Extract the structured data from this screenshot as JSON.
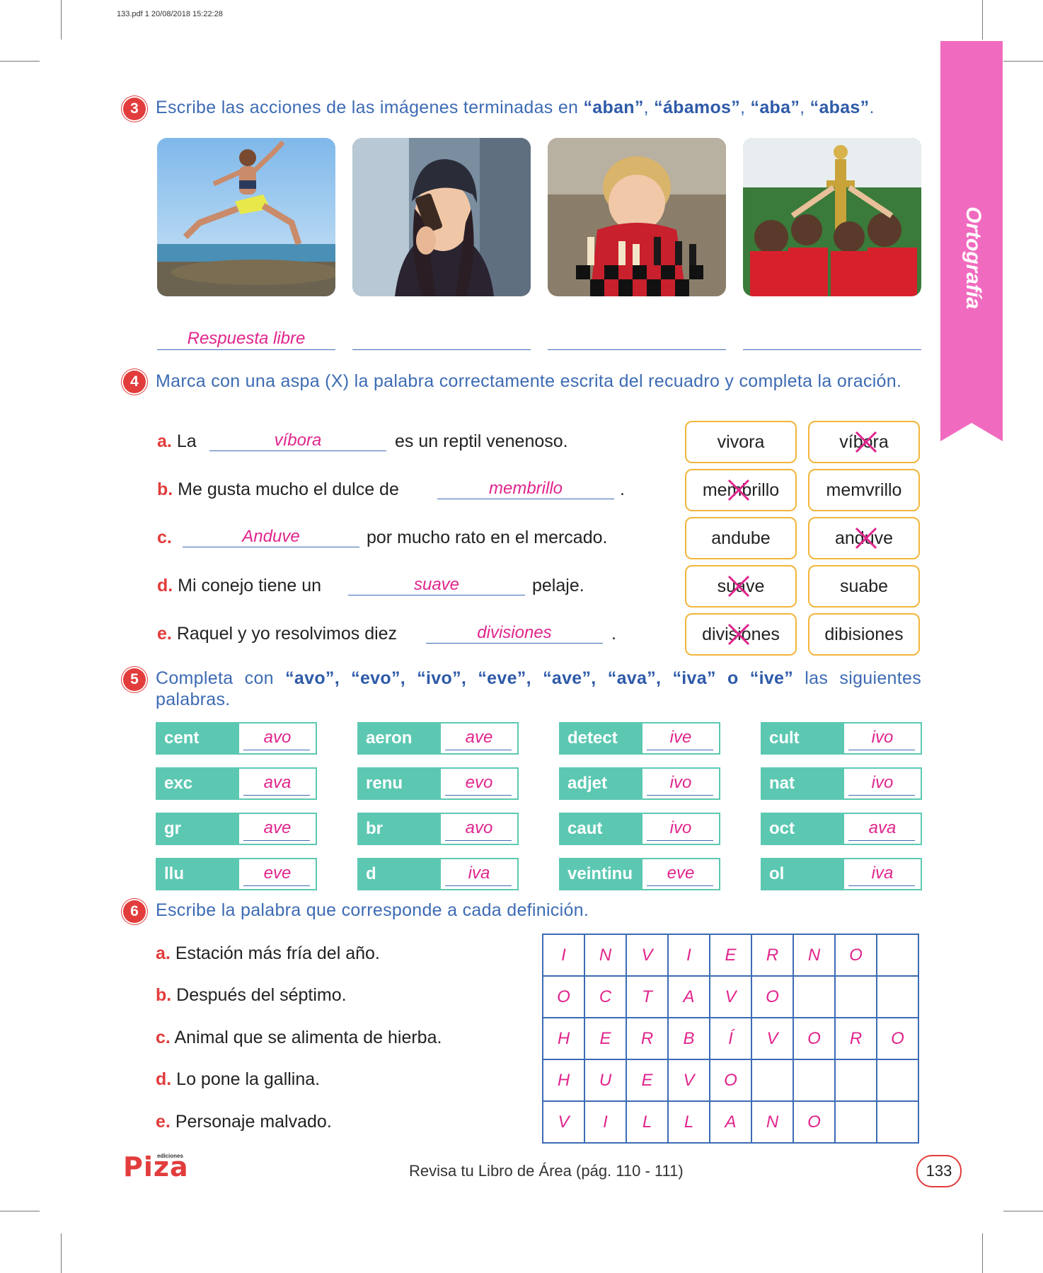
{
  "pdf_header": "133.pdf   1   20/08/2018   15:22:28",
  "side_tab": "Ortografía",
  "ex3": {
    "number": "3",
    "instruction_pre": "Escribe las acciones de las imágenes terminadas en ",
    "terms": [
      "“aban”",
      ", ",
      "“ábamos”",
      ", ",
      "“aba”",
      ", ",
      "“abas”",
      "."
    ],
    "answers": [
      "Respuesta libre",
      "",
      "",
      ""
    ]
  },
  "ex4": {
    "number": "4",
    "instruction": "Marca con una aspa (X) la palabra correctamente escrita del recuadro y completa la oración.",
    "items": [
      {
        "letter": "a.",
        "before": "La",
        "answer": "víbora",
        "after": "es un reptil venenoso.",
        "opt1": "vivora",
        "opt2": "víbora"
      },
      {
        "letter": "b.",
        "before": "Me gusta mucho el dulce de",
        "answer": "membrillo",
        "after": ".",
        "opt1": "membrillo",
        "opt2": "memvrillo"
      },
      {
        "letter": "c.",
        "before": "",
        "answer": "Anduve",
        "after": "por mucho rato en el mercado.",
        "opt1": "andube",
        "opt2": "anduve"
      },
      {
        "letter": "d.",
        "before": "Mi conejo tiene un",
        "answer": "suave",
        "after": "pelaje.",
        "opt1": "suave",
        "opt2": "suabe"
      },
      {
        "letter": "e.",
        "before": "Raquel y yo resolvimos diez",
        "answer": "divisiones",
        "after": ".",
        "opt1": "divisiones",
        "opt2": "dibisiones"
      }
    ]
  },
  "ex5": {
    "number": "5",
    "instruction_pre": "Completa con ",
    "instruction_terms": "“avo”, “evo”, “ivo”, “eve”, “ave”, “ava”, “iva” o “ive”",
    "instruction_post": " las siguientes palabras.",
    "rows": [
      [
        {
          "stem": "cent",
          "ans": "avo"
        },
        {
          "stem": "aeron",
          "ans": "ave"
        },
        {
          "stem": "detect",
          "ans": "ive"
        },
        {
          "stem": "cult",
          "ans": "ivo"
        }
      ],
      [
        {
          "stem": "exc",
          "ans": "ava"
        },
        {
          "stem": "renu",
          "ans": "evo"
        },
        {
          "stem": "adjet",
          "ans": "ivo"
        },
        {
          "stem": "nat",
          "ans": "ivo"
        }
      ],
      [
        {
          "stem": "gr",
          "ans": "ave"
        },
        {
          "stem": "br",
          "ans": "avo"
        },
        {
          "stem": "caut",
          "ans": "ivo"
        },
        {
          "stem": "oct",
          "ans": "ava"
        }
      ],
      [
        {
          "stem": "llu",
          "ans": "eve"
        },
        {
          "stem": "d",
          "ans": "iva"
        },
        {
          "stem": "veintinu",
          "ans": "eve"
        },
        {
          "stem": "ol",
          "ans": "iva"
        }
      ]
    ]
  },
  "ex6": {
    "number": "6",
    "instruction": "Escribe la palabra que corresponde a cada definición.",
    "definitions": [
      {
        "letter": "a.",
        "text": "Estación más fría del año."
      },
      {
        "letter": "b.",
        "text": "Después del séptimo."
      },
      {
        "letter": "c.",
        "text": "Animal que se alimenta de hierba."
      },
      {
        "letter": "d.",
        "text": "Lo pone la gallina."
      },
      {
        "letter": "e.",
        "text": "Personaje malvado."
      }
    ],
    "grid": [
      [
        "I",
        "N",
        "V",
        "I",
        "E",
        "R",
        "N",
        "O",
        ""
      ],
      [
        "O",
        "C",
        "T",
        "A",
        "V",
        "O",
        "",
        "",
        ""
      ],
      [
        "H",
        "E",
        "R",
        "B",
        "Í",
        "V",
        "O",
        "R",
        "O"
      ],
      [
        "H",
        "U",
        "E",
        "V",
        "O",
        "",
        "",
        "",
        ""
      ],
      [
        "V",
        "I",
        "L",
        "L",
        "A",
        "N",
        "O",
        "",
        ""
      ]
    ]
  },
  "footer": "Revisa tu Libro de Área (pág. 110 - 111)",
  "page_number": "133",
  "logo": "Piza",
  "logo_sub": "ediciones"
}
